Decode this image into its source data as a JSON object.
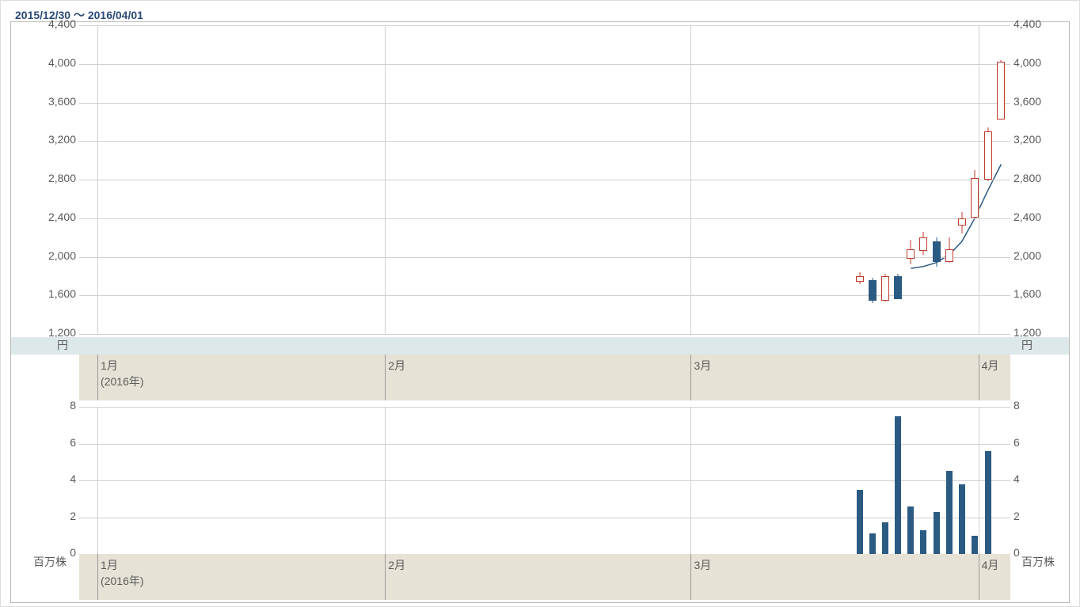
{
  "date_range": "2015/12/30 ～ 2016/04/01",
  "price_unit": "円",
  "volume_unit": "百万株",
  "x_ticks": [
    {
      "pos": 0.02,
      "label": "1月",
      "sub": "(2016年)"
    },
    {
      "pos": 0.335,
      "label": "2月",
      "sub": ""
    },
    {
      "pos": 0.67,
      "label": "3月",
      "sub": ""
    },
    {
      "pos": 0.985,
      "label": "4月",
      "sub": ""
    }
  ],
  "chart_data": {
    "type": "candlestick",
    "title": "",
    "xlabel": "",
    "ylabel": "円",
    "ylabel2": "百万株",
    "ylim": [
      1200,
      4400
    ],
    "y_ticks_price": [
      1200,
      1600,
      2000,
      2400,
      2800,
      3200,
      3600,
      4000,
      4400
    ],
    "ylim_vol": [
      0,
      8
    ],
    "y_ticks_volume": [
      0,
      2,
      4,
      6,
      8
    ],
    "x_range": "2015/12/30–2016/04/01",
    "series": [
      {
        "name": "price",
        "type": "candlestick",
        "values_ref": "candles"
      },
      {
        "name": "moving_avg",
        "type": "line",
        "values_ref": "ma"
      },
      {
        "name": "volume",
        "type": "bar",
        "values_ref": "volumes"
      }
    ],
    "candles": [
      {
        "x": 0.855,
        "open": 1760,
        "high": 1840,
        "low": 1720,
        "close": 1800
      },
      {
        "x": 0.869,
        "open": 1760,
        "high": 1780,
        "low": 1520,
        "close": 1560
      },
      {
        "x": 0.883,
        "open": 1560,
        "high": 1820,
        "low": 1540,
        "close": 1800
      },
      {
        "x": 0.897,
        "open": 1800,
        "high": 1820,
        "low": 1560,
        "close": 1580
      },
      {
        "x": 0.911,
        "open": 2000,
        "high": 2180,
        "low": 1920,
        "close": 2080
      },
      {
        "x": 0.925,
        "open": 2080,
        "high": 2260,
        "low": 2020,
        "close": 2200
      },
      {
        "x": 0.939,
        "open": 2160,
        "high": 2200,
        "low": 1900,
        "close": 1960
      },
      {
        "x": 0.953,
        "open": 1960,
        "high": 2200,
        "low": 1940,
        "close": 2080
      },
      {
        "x": 0.967,
        "open": 2340,
        "high": 2460,
        "low": 2240,
        "close": 2400
      },
      {
        "x": 0.981,
        "open": 2420,
        "high": 2900,
        "low": 2400,
        "close": 2820
      },
      {
        "x": 0.996,
        "open": 2820,
        "high": 3340,
        "low": 2780,
        "close": 3300
      },
      {
        "x": 1.01,
        "open": 3440,
        "high": 4040,
        "low": 3420,
        "close": 4020
      }
    ],
    "ma": [
      {
        "x": 0.911,
        "y": 1880
      },
      {
        "x": 0.925,
        "y": 1900
      },
      {
        "x": 0.939,
        "y": 1940
      },
      {
        "x": 0.953,
        "y": 2020
      },
      {
        "x": 0.967,
        "y": 2160
      },
      {
        "x": 0.981,
        "y": 2400
      },
      {
        "x": 0.996,
        "y": 2700
      },
      {
        "x": 1.01,
        "y": 2960
      }
    ],
    "volumes": [
      {
        "x": 0.855,
        "v": 3.5
      },
      {
        "x": 0.869,
        "v": 1.1
      },
      {
        "x": 0.883,
        "v": 1.7
      },
      {
        "x": 0.897,
        "v": 7.5
      },
      {
        "x": 0.911,
        "v": 2.6
      },
      {
        "x": 0.925,
        "v": 1.3
      },
      {
        "x": 0.939,
        "v": 2.3
      },
      {
        "x": 0.953,
        "v": 4.5
      },
      {
        "x": 0.967,
        "v": 3.8
      },
      {
        "x": 0.981,
        "v": 1.0
      },
      {
        "x": 0.996,
        "v": 5.6
      }
    ]
  }
}
